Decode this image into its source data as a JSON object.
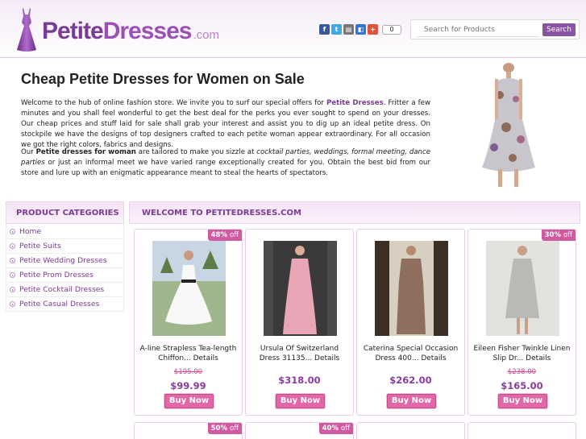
{
  "brand": {
    "name_part1": "Petite",
    "name_part2": "Dresses",
    "tld": ".com"
  },
  "social": {
    "icons": [
      "facebook-icon",
      "twitter-icon",
      "print-icon",
      "delicious-icon",
      "google-plus-icon"
    ],
    "share_count": "0"
  },
  "search": {
    "placeholder": "Search for Products",
    "button_label": "Search"
  },
  "intro": {
    "title": "Cheap Petite Dresses for Women on Sale",
    "p1_before": "Welcome to the hub of online fashion store. We invite you to surf our special offers for ",
    "p1_highlight": "Petite Dresses",
    "p1_after": ". Fritter a few minutes and you shall feel wonderful to get the best deal for the perks you ever sought to spend on your dresses. Our cheap prices and stuff laid for sale shall grab your interest and assist you to dig up an ideal petite dress. On stockpile we have the designs of top designers crafted to each petite woman appear extraordinary. For all occasion we got the right colors, fabrics and designs.",
    "p2_lead": "Our ",
    "p2_bold": "Petite dresses for woman",
    "p2_mid": " are tailored to make you sizzle at ",
    "p2_italic": "cocktail parties, weddings, formal meeting, dance parties",
    "p2_after": " or just an informal meet we have varied range exceptionally created for you. Obtain the best bid from our store and lure up with an enigmatic appearance meant to steal the hearts of spectators."
  },
  "sidebar": {
    "title": "PRODUCT CATEGORIES",
    "items": [
      {
        "label": "Home"
      },
      {
        "label": "Petite Suits"
      },
      {
        "label": "Petite Wedding Dresses"
      },
      {
        "label": "Petite Prom Dresses"
      },
      {
        "label": "Petite Cocktail Dresses"
      },
      {
        "label": "Petite Casual Dresses"
      }
    ]
  },
  "welcome": {
    "title": "WELCOME TO PETITEDRESSES.COM"
  },
  "products": [
    {
      "badge_pct": "48%",
      "badge_off": "off",
      "name": "A-line Strapless Tea-length Chiffon...",
      "details": "Details",
      "old_price": "$195.00",
      "price": "$99.99",
      "buy_label": "Buy Now",
      "color": "#ffffff"
    },
    {
      "badge_pct": "",
      "badge_off": "",
      "name": "Ursula Of Switzerland Dress 31135...",
      "details": "Details",
      "old_price": "",
      "price": "$318.00",
      "buy_label": "Buy Now",
      "color": "#e8a6b6"
    },
    {
      "badge_pct": "",
      "badge_off": "",
      "name": "Caterina Special Occasion Dress 400...",
      "details": "Details",
      "old_price": "",
      "price": "$262.00",
      "buy_label": "Buy Now",
      "color": "#8e6e5f"
    },
    {
      "badge_pct": "30%",
      "badge_off": "off",
      "name": "Eileen Fisher Twinkle Linen Slip Dr...",
      "details": "Details",
      "old_price": "$238.00",
      "price": "$165.00",
      "buy_label": "Buy Now",
      "color": "#b9b9b5"
    }
  ],
  "products_row2": [
    {
      "badge_pct": "50%",
      "badge_off": "off"
    },
    {
      "badge_pct": "40%",
      "badge_off": "off"
    },
    {
      "badge_pct": "",
      "badge_off": ""
    },
    {
      "badge_pct": "",
      "badge_off": ""
    }
  ],
  "colors": {
    "accent": "#7a3b95",
    "buy_button": "#e068a6",
    "badge": "#d05aa0",
    "price": "#8b3ba0"
  }
}
